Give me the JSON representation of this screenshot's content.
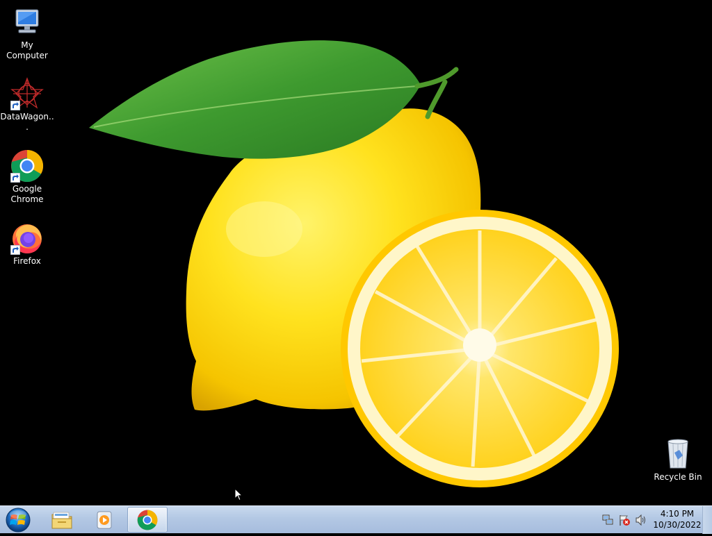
{
  "desktop": {
    "icons": [
      {
        "label": "My Computer"
      },
      {
        "label": "DataWagon..."
      },
      {
        "label": "Google Chrome"
      },
      {
        "label": "Firefox"
      },
      {
        "label": "Recycle Bin"
      }
    ],
    "wallpaper": "lemon-wallpaper"
  },
  "taskbar": {
    "start_icon": "windows-logo-icon",
    "pinned": [
      {
        "name": "file-explorer-icon",
        "active": false
      },
      {
        "name": "media-player-icon",
        "active": false
      },
      {
        "name": "chrome-icon",
        "active": true
      }
    ],
    "tray": {
      "icons": [
        "network-icon",
        "action-center-flag-icon",
        "volume-icon"
      ],
      "time": "4:10 PM",
      "date": "10/30/2022"
    }
  }
}
